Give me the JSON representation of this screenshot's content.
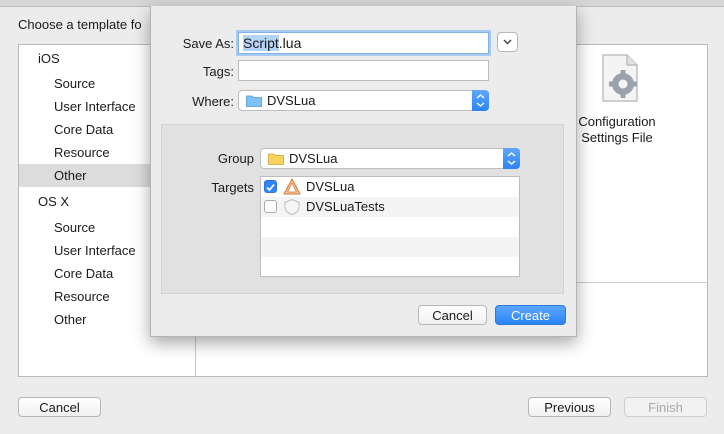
{
  "chooser": {
    "title": "Choose a template fo",
    "sidebar": [
      {
        "label": "iOS",
        "kind": "group"
      },
      {
        "label": "Source",
        "kind": "item"
      },
      {
        "label": "User Interface",
        "kind": "item"
      },
      {
        "label": "Core Data",
        "kind": "item"
      },
      {
        "label": "Resource",
        "kind": "item"
      },
      {
        "label": "Other",
        "kind": "item",
        "selected": true
      },
      {
        "label": "OS X",
        "kind": "group"
      },
      {
        "label": "Source",
        "kind": "item"
      },
      {
        "label": "User Interface",
        "kind": "item"
      },
      {
        "label": "Core Data",
        "kind": "item"
      },
      {
        "label": "Resource",
        "kind": "item"
      },
      {
        "label": "Other",
        "kind": "item"
      }
    ],
    "template_label_line1": "Configuration",
    "template_label_line2": "Settings File",
    "template_icon": "settings-document-icon",
    "cancel_label": "Cancel",
    "previous_label": "Previous",
    "finish_label": "Finish"
  },
  "save_sheet": {
    "save_as_label": "Save As:",
    "filename_selected": "Script",
    "filename_rest": ".lua",
    "tags_label": "Tags:",
    "tags_value": "",
    "where_label": "Where:",
    "where_value": "DVSLua",
    "group_label": "Group",
    "group_value": "DVSLua",
    "targets_label": "Targets",
    "targets": [
      {
        "name": "DVSLua",
        "checked": true,
        "icon": "app-target-icon"
      },
      {
        "name": "DVSLuaTests",
        "checked": false,
        "icon": "test-target-icon"
      }
    ],
    "cancel_label": "Cancel",
    "create_label": "Create"
  },
  "colors": {
    "accent": "#2a83f6",
    "selection": "#b3d3f9",
    "folder": "#f7d35c"
  }
}
